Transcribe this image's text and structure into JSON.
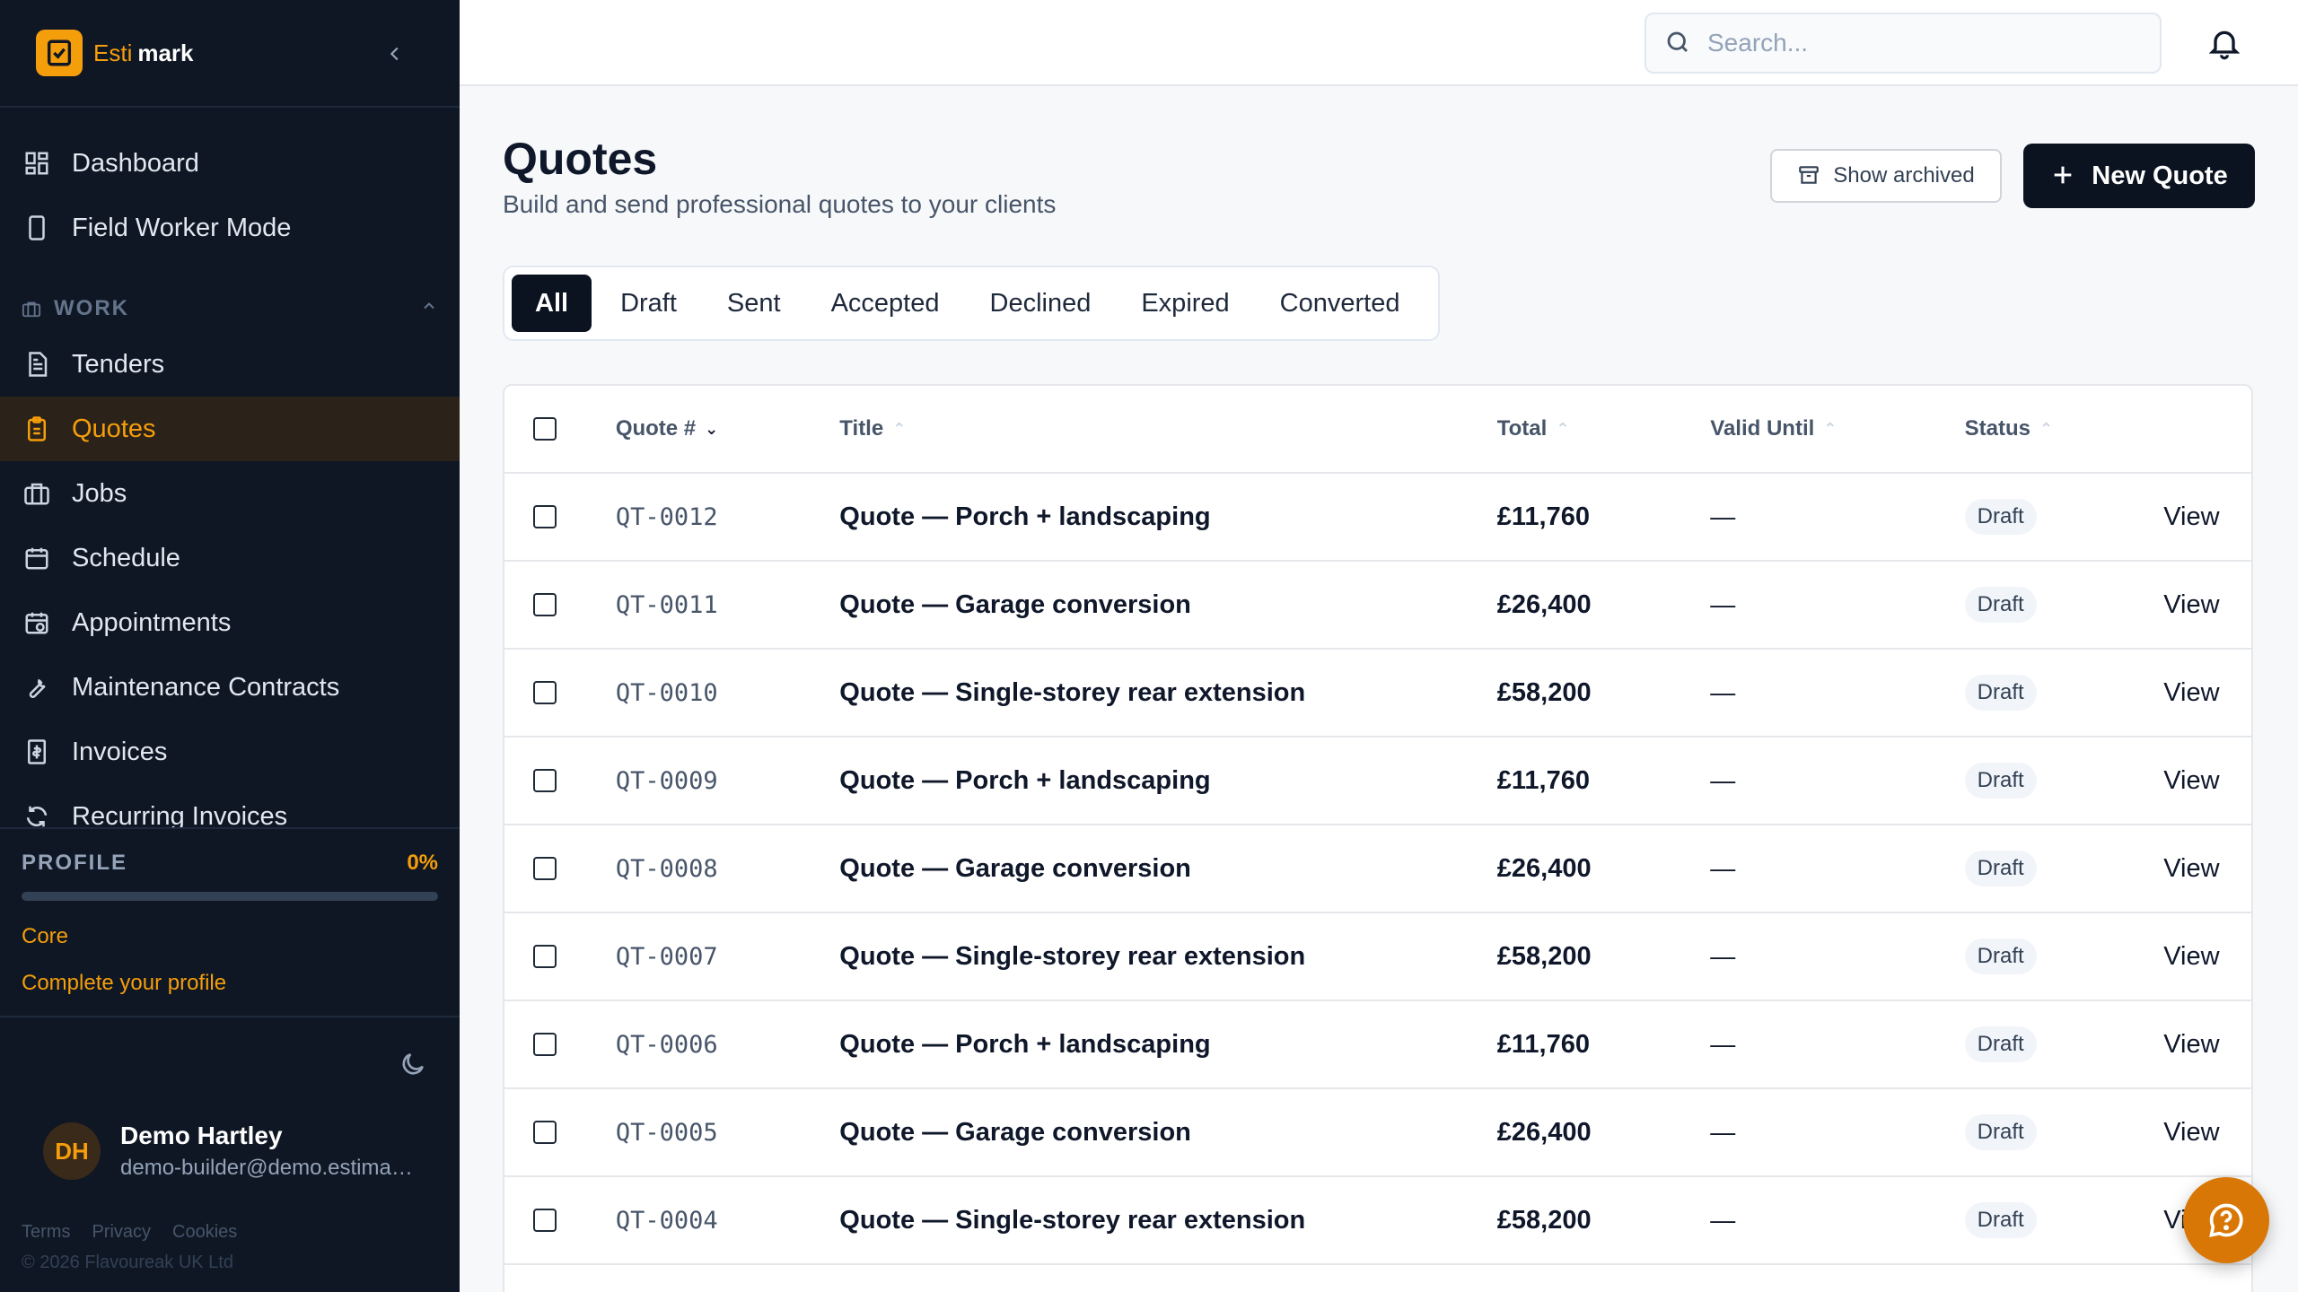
{
  "brand": {
    "name_part1": "Esti",
    "name_part2": "mark"
  },
  "sidebar": {
    "top_items": [
      {
        "label": "Dashboard",
        "icon": "grid-icon"
      },
      {
        "label": "Field Worker Mode",
        "icon": "phone-icon"
      }
    ],
    "section_label": "WORK",
    "work_items": [
      {
        "label": "Tenders",
        "icon": "document-icon"
      },
      {
        "label": "Quotes",
        "icon": "clipboard-icon",
        "active": true
      },
      {
        "label": "Jobs",
        "icon": "briefcase-icon"
      },
      {
        "label": "Schedule",
        "icon": "calendar-icon"
      },
      {
        "label": "Appointments",
        "icon": "calendar-clock-icon"
      },
      {
        "label": "Maintenance Contracts",
        "icon": "wrench-icon"
      },
      {
        "label": "Invoices",
        "icon": "receipt-icon"
      },
      {
        "label": "Recurring Invoices",
        "icon": "refresh-icon"
      }
    ],
    "profile": {
      "label": "PROFILE",
      "percent_text": "0%",
      "progress": 0,
      "tier": "Core",
      "cta": "Complete your profile"
    },
    "user": {
      "initials": "DH",
      "name": "Demo Hartley",
      "email": "demo-builder@demo.estimark.co.uk"
    },
    "footer_links": [
      "Terms",
      "Privacy",
      "Cookies"
    ],
    "copyright": "© 2026 Flavoureak UK Ltd"
  },
  "topbar": {
    "search_placeholder": "Search..."
  },
  "page": {
    "title": "Quotes",
    "subtitle": "Build and send professional quotes to your clients",
    "show_archived_label": "Show archived",
    "new_quote_label": "New Quote"
  },
  "tabs": [
    "All",
    "Draft",
    "Sent",
    "Accepted",
    "Declined",
    "Expired",
    "Converted"
  ],
  "active_tab": "All",
  "table": {
    "columns": [
      "Quote #",
      "Title",
      "Total",
      "Valid Until",
      "Status"
    ],
    "rows": [
      {
        "id": "QT-0012",
        "title": "Quote — Porch + landscaping",
        "total": "£11,760",
        "valid_until": "—",
        "status": "Draft",
        "action": "View"
      },
      {
        "id": "QT-0011",
        "title": "Quote — Garage conversion",
        "total": "£26,400",
        "valid_until": "—",
        "status": "Draft",
        "action": "View"
      },
      {
        "id": "QT-0010",
        "title": "Quote — Single-storey rear extension",
        "total": "£58,200",
        "valid_until": "—",
        "status": "Draft",
        "action": "View"
      },
      {
        "id": "QT-0009",
        "title": "Quote — Porch + landscaping",
        "total": "£11,760",
        "valid_until": "—",
        "status": "Draft",
        "action": "View"
      },
      {
        "id": "QT-0008",
        "title": "Quote — Garage conversion",
        "total": "£26,400",
        "valid_until": "—",
        "status": "Draft",
        "action": "View"
      },
      {
        "id": "QT-0007",
        "title": "Quote — Single-storey rear extension",
        "total": "£58,200",
        "valid_until": "—",
        "status": "Draft",
        "action": "View"
      },
      {
        "id": "QT-0006",
        "title": "Quote — Porch + landscaping",
        "total": "£11,760",
        "valid_until": "—",
        "status": "Draft",
        "action": "View"
      },
      {
        "id": "QT-0005",
        "title": "Quote — Garage conversion",
        "total": "£26,400",
        "valid_until": "—",
        "status": "Draft",
        "action": "View"
      },
      {
        "id": "QT-0004",
        "title": "Quote — Single-storey rear extension",
        "total": "£58,200",
        "valid_until": "—",
        "status": "Draft",
        "action": "View"
      }
    ]
  },
  "colors": {
    "accent": "#f59e0b",
    "sidebar_bg": "#0f1724",
    "primary_button": "#0b1220"
  }
}
